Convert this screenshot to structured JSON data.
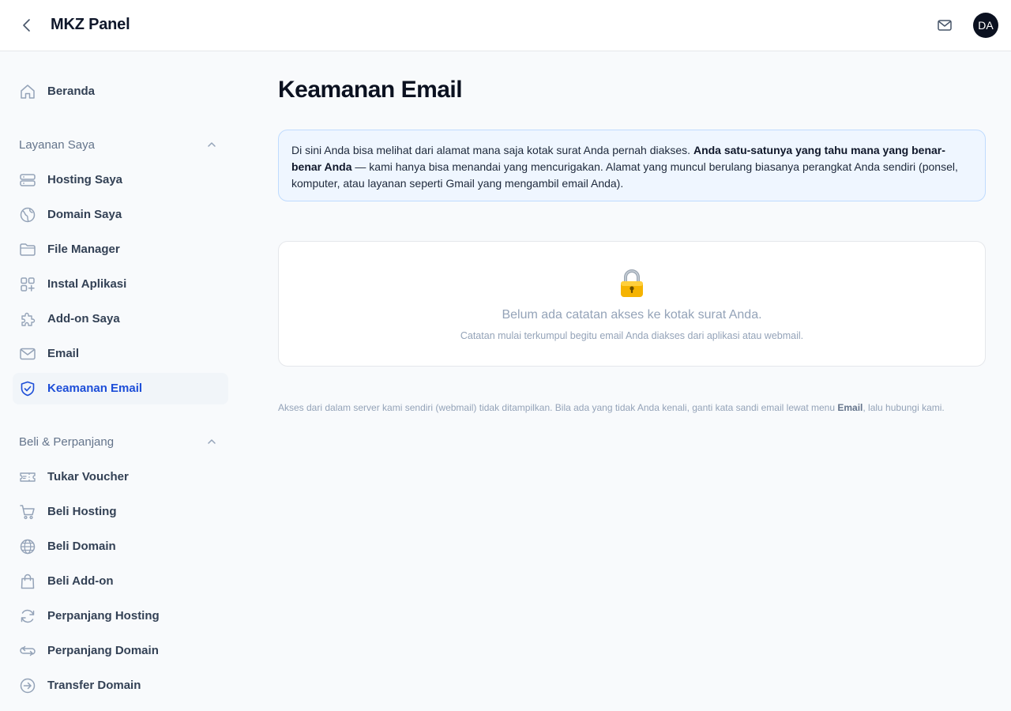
{
  "header": {
    "title": "MKZ Panel",
    "avatar_initials": "DA",
    "back_icon": "chevron-left-icon",
    "mail_icon": "mail-icon"
  },
  "sidebar": {
    "home": {
      "label": "Beranda",
      "icon": "home-icon"
    },
    "sections": [
      {
        "title": "Layanan Saya",
        "expanded": true,
        "items": [
          {
            "label": "Hosting Saya",
            "icon": "server-icon"
          },
          {
            "label": "Domain Saya",
            "icon": "globe-icon"
          },
          {
            "label": "File Manager",
            "icon": "folder-icon"
          },
          {
            "label": "Instal Aplikasi",
            "icon": "apps-plus-icon"
          },
          {
            "label": "Add-on Saya",
            "icon": "puzzle-icon"
          },
          {
            "label": "Email",
            "icon": "mail-icon"
          },
          {
            "label": "Keamanan Email",
            "icon": "shield-check-icon",
            "active": true
          }
        ]
      },
      {
        "title": "Beli & Perpanjang",
        "expanded": true,
        "items": [
          {
            "label": "Tukar Voucher",
            "icon": "ticket-icon"
          },
          {
            "label": "Beli Hosting",
            "icon": "cart-icon"
          },
          {
            "label": "Beli Domain",
            "icon": "globe-icon"
          },
          {
            "label": "Beli Add-on",
            "icon": "shopping-bag-icon"
          },
          {
            "label": "Perpanjang Hosting",
            "icon": "refresh-icon"
          },
          {
            "label": "Perpanjang Domain",
            "icon": "refresh-icon"
          },
          {
            "label": "Transfer Domain",
            "icon": "arrow-right-circle-icon"
          }
        ]
      }
    ]
  },
  "main": {
    "title": "Keamanan Email",
    "info": {
      "text_before": "Di sini Anda bisa melihat dari alamat mana saja kotak surat Anda pernah diakses. ",
      "text_bold": "Anda satu-satunya yang tahu mana yang benar-benar Anda",
      "text_after": " — kami hanya bisa menandai yang mencurigakan. Alamat yang muncul berulang biasanya perangkat Anda sendiri (ponsel, komputer, atau layanan seperti Gmail yang mengambil email Anda)."
    },
    "empty_state": {
      "icon": "lock-icon",
      "title": "Belum ada catatan akses ke kotak surat Anda.",
      "subtitle": "Catatan mulai terkumpul begitu email Anda diakses dari aplikasi atau webmail."
    },
    "footnote": {
      "text_before": "Akses dari dalam server kami sendiri (webmail) tidak ditampilkan. Bila ada yang tidak Anda kenali, ganti kata sandi email lewat menu ",
      "text_bold": "Email",
      "text_after": ", lalu hubungi kami."
    }
  },
  "colors": {
    "accent": "#1d4ed8",
    "info_bg": "#eff6ff",
    "info_border": "#bfdbfe",
    "avatar_bg": "#0b1120"
  }
}
